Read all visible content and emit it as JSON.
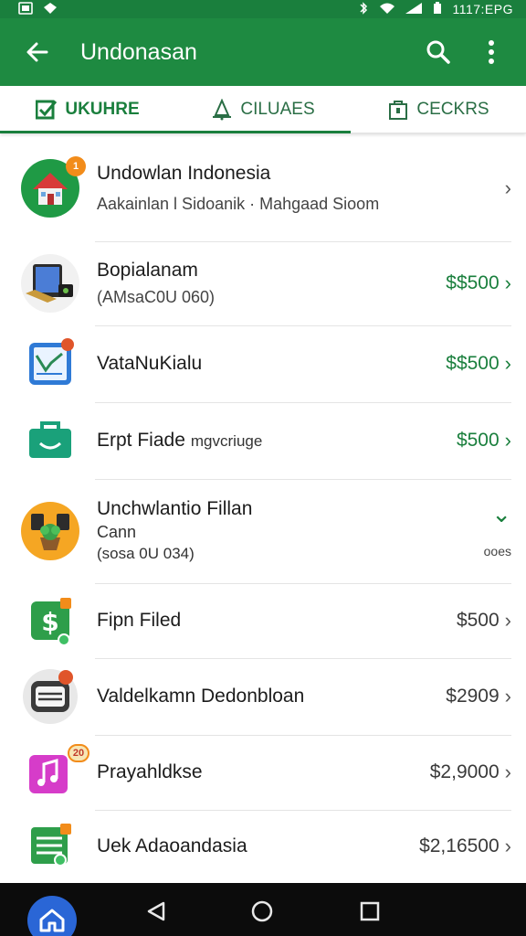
{
  "status_bar": {
    "left_icons": [
      "gallery-icon",
      "notification-icon"
    ],
    "right_icons": [
      "bluetooth-icon",
      "wifi-icon",
      "signal-icon",
      "battery-icon"
    ],
    "time_text": "1117:EPG"
  },
  "app_bar": {
    "title": "Undonasan",
    "color": "#1e8a41"
  },
  "tabs": [
    {
      "label": "UKUHRE",
      "icon": "check-square-icon",
      "active": true
    },
    {
      "label": "CILUAES",
      "icon": "bell-icon",
      "active": false
    },
    {
      "label": "CECKRS",
      "icon": "box-icon",
      "active": false
    }
  ],
  "list": [
    {
      "title": "Undowlan Indonesia",
      "subtitle": "Aakainlan l Sidoanik · Mahgaad Sioom",
      "price": "",
      "icon": "house-icon",
      "badge": "1",
      "chevron": "›"
    },
    {
      "title": "Bopialanam",
      "subtitle": "(AMsaC0U 060)",
      "price": "$$500",
      "icon": "tablet-icon",
      "badge": "",
      "chevron": "›"
    },
    {
      "title": "VataNuKialu",
      "subtitle": "",
      "price": "$$500",
      "icon": "chart-icon",
      "badge": "",
      "chevron": "›"
    },
    {
      "title": "Erpt Fiade",
      "title_extra": "mgvcriuge",
      "subtitle": "",
      "price": "$500",
      "icon": "bag-icon",
      "badge": "",
      "chevron": "›"
    },
    {
      "title": "Unchwlantio Fillan",
      "subtitle": "Cann",
      "subtitle2": "(sosa 0U 034)",
      "price": "",
      "right_text": "ooes",
      "icon": "plant-icon",
      "badge": "",
      "chevron": "⌄"
    },
    {
      "title": "Fipn Filed",
      "subtitle": "",
      "price": "$500",
      "icon": "dollar-icon",
      "badge": "",
      "chevron": "›"
    },
    {
      "title": "Valdelkamn Dedonbloan",
      "subtitle": "",
      "price": "$2909",
      "icon": "card-icon",
      "badge": "",
      "chevron": "›"
    },
    {
      "title": "Prayahldkse",
      "subtitle": "",
      "price": "$2,9000",
      "icon": "music-icon",
      "badge": "20",
      "chevron": "›"
    },
    {
      "title": "Uek Adaoandasia",
      "subtitle": "",
      "price": "$2,16500",
      "icon": "list-icon",
      "badge": "",
      "chevron": "›"
    }
  ],
  "nav_bar": {
    "buttons": [
      "home-icon",
      "back-triangle-icon",
      "home-circle-icon",
      "recents-square-icon"
    ]
  }
}
